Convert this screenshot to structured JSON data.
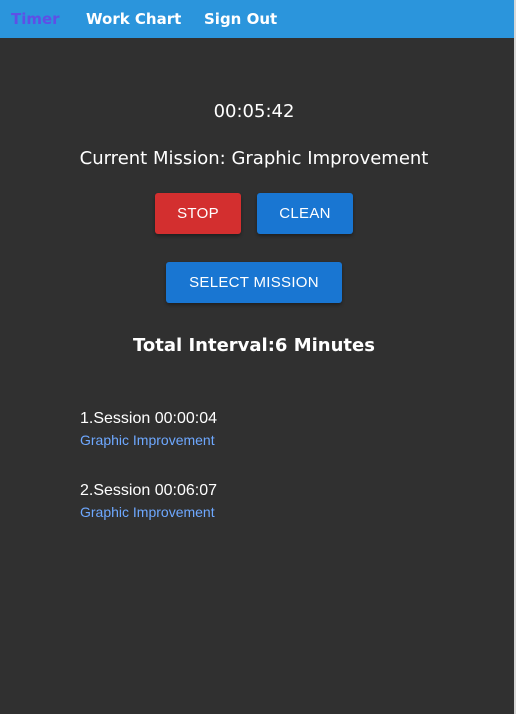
{
  "nav": {
    "items": [
      {
        "label": "Timer",
        "active": true
      },
      {
        "label": "Work Chart",
        "active": false
      },
      {
        "label": "Sign Out",
        "active": false
      }
    ]
  },
  "timer": {
    "elapsed": "00:05:42",
    "current_mission": "Current Mission: Graphic Improvement"
  },
  "controls": {
    "stop_label": "STOP",
    "clean_label": "CLEAN",
    "select_mission_label": "SELECT MISSION"
  },
  "summary": {
    "total_interval": "Total Interval:6 Minutes"
  },
  "sessions": [
    {
      "title": "1.Session 00:00:04",
      "mission": "Graphic Improvement"
    },
    {
      "title": "2.Session 00:06:07",
      "mission": "Graphic Improvement"
    }
  ],
  "colors": {
    "navbar": "#2b95dc",
    "nav_active": "#5f4fe6",
    "background": "#303030",
    "stop": "#d32f2f",
    "primary": "#1976d2",
    "link": "#6ea8ff"
  }
}
